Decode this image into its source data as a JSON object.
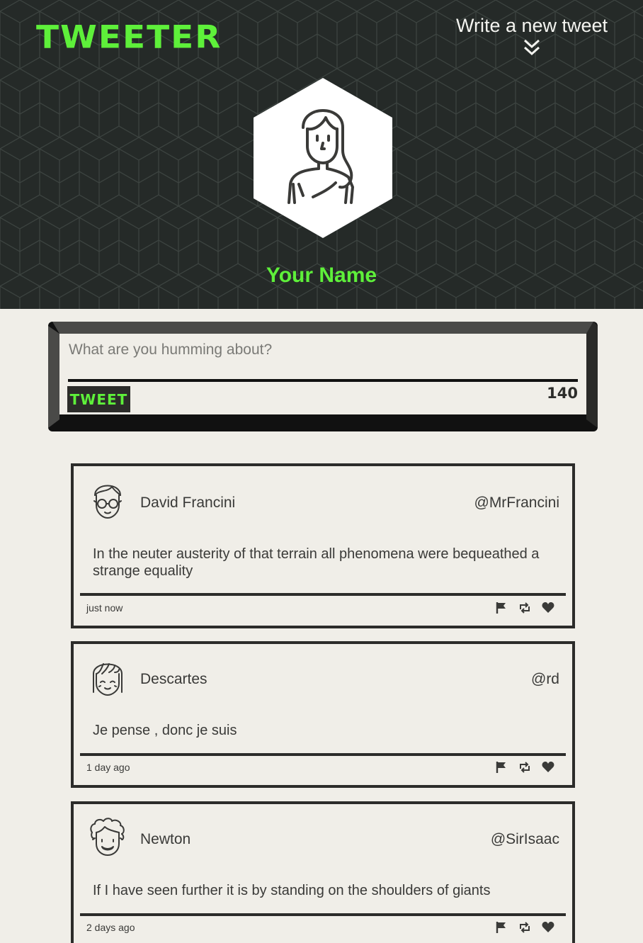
{
  "nav": {
    "brand": "TWEETER",
    "compose_toggle_label": "Write a new tweet"
  },
  "profile": {
    "name": "Your Name"
  },
  "composer": {
    "placeholder": "What are you humming about?",
    "submit_label": "TWEET",
    "char_counter": "140"
  },
  "colors": {
    "accent": "#5ef03a",
    "header_bg": "#252a28",
    "page_bg": "#f0eee8",
    "text": "#2c2c2a"
  },
  "tweets": [
    {
      "author": "David Francini",
      "handle": "@MrFrancini",
      "content": "In the neuter austerity of that terrain all phenomena were bequeathed a strange equality",
      "timestamp": "just now",
      "avatar_icon": "man-with-glasses-avatar-icon",
      "actions": [
        "flag-icon",
        "retweet-icon",
        "heart-icon"
      ]
    },
    {
      "author": "Descartes",
      "handle": "@rd",
      "content": "Je pense , donc je suis",
      "timestamp": "1 day ago",
      "avatar_icon": "girl-with-bangs-avatar-icon",
      "actions": [
        "flag-icon",
        "retweet-icon",
        "heart-icon"
      ]
    },
    {
      "author": "Newton",
      "handle": "@SirIsaac",
      "content": "If I have seen further it is by standing on the shoulders of giants",
      "timestamp": "2 days ago",
      "avatar_icon": "curly-hair-avatar-icon",
      "actions": [
        "flag-icon",
        "retweet-icon",
        "heart-icon"
      ]
    }
  ]
}
